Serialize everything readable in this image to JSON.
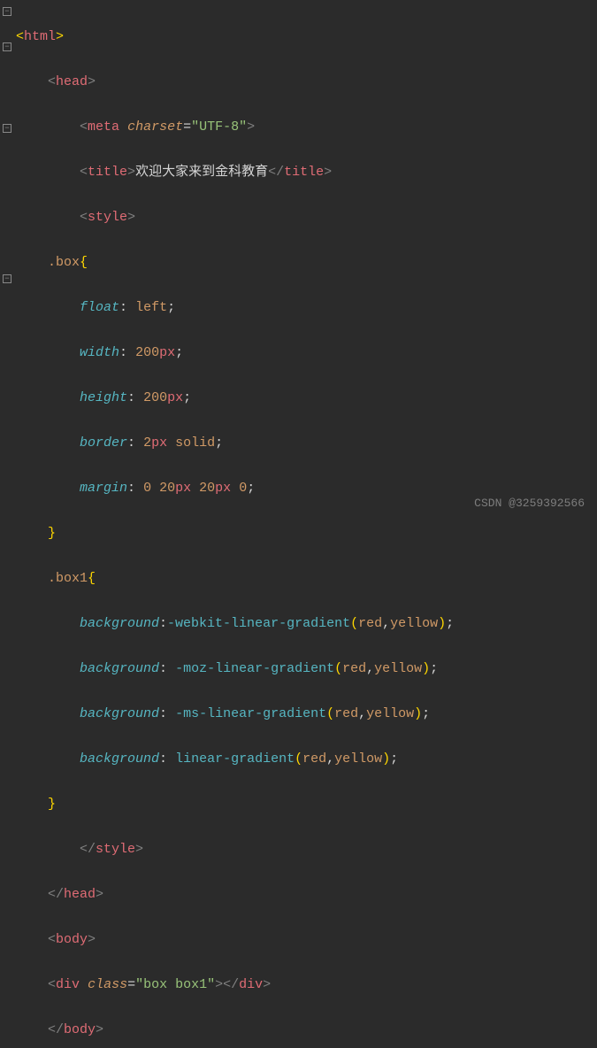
{
  "code": {
    "l1_tag": "html",
    "l2_tag": "head",
    "l3_tag": "meta",
    "l3_attr": "charset",
    "l3_val": "\"UTF-8\"",
    "l4_tag": "title",
    "l4_text": "欢迎大家来到金科教育",
    "l5_tag": "style",
    "l6_sel": ".box",
    "l7_prop": "float",
    "l7_val": "left",
    "l8_prop": "width",
    "l8_num": "200",
    "l8_unit": "px",
    "l9_prop": "height",
    "l9_num": "200",
    "l9_unit": "px",
    "l10_prop": "border",
    "l10_num": "2",
    "l10_unit": "px",
    "l10_kw": "solid",
    "l11_prop": "margin",
    "l11_a": "0",
    "l11_b": "20",
    "l11_bu": "px",
    "l11_c": "20",
    "l11_cu": "px",
    "l11_d": "0",
    "l13_sel": ".box1",
    "l14_prop": "background",
    "l14_func": "-webkit-linear-gradient",
    "l14_a": "red",
    "l14_b": "yellow",
    "l15_prop": "background",
    "l15_func": "-moz-linear-gradient",
    "l15_a": "red",
    "l15_b": "yellow",
    "l16_prop": "background",
    "l16_func": "-ms-linear-gradient",
    "l16_a": "red",
    "l16_b": "yellow",
    "l17_prop": "background",
    "l17_func": "linear-gradient",
    "l17_a": "red",
    "l17_b": "yellow",
    "l19_tag": "style",
    "l20_tag": "head",
    "l21_tag": "body",
    "l22_tag": "div",
    "l22_attr": "class",
    "l22_val": "\"box box1\"",
    "l23_tag": "body"
  },
  "watermark": "CSDN @3259392566"
}
